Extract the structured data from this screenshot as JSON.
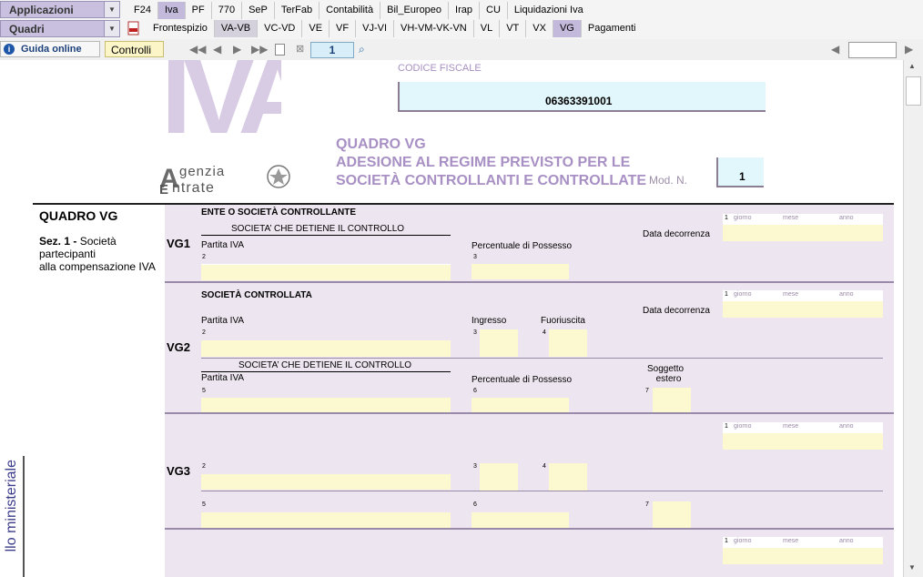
{
  "menu": {
    "applicazioni": "Applicazioni",
    "quadri": "Quadri",
    "top_tabs": [
      "F24",
      "Iva",
      "PF",
      "770",
      "SeP",
      "TerFab",
      "Contabilità",
      "Bil_Europeo",
      "Irap",
      "CU",
      "Liquidazioni Iva"
    ],
    "active_top_tab": "Iva",
    "sub_tabs": [
      "Frontespizio",
      "VA-VB",
      "VC-VD",
      "VE",
      "VF",
      "VJ-VI",
      "VH-VM-VK-VN",
      "VL",
      "VT",
      "VX",
      "VG",
      "Pagamenti"
    ],
    "active_sub_tabs": [
      "VA-VB",
      "VG"
    ]
  },
  "toolbar": {
    "guida_label": "Guida online",
    "controlli_label": "Controlli",
    "page_number": "1",
    "goto_value": ""
  },
  "form": {
    "codice_fiscale_label": "CODICE FISCALE",
    "codice_fiscale": "06363391001",
    "title_line1": "QUADRO VG",
    "title_line2": "ADESIONE AL REGIME PREVISTO PER LE",
    "title_line3": "SOCIETÀ CONTROLLANTI E CONTROLLATE",
    "mod_label": "Mod. N.",
    "mod_value": "1",
    "agenzia_line1": "genzia",
    "agenzia_line2": "ntrate",
    "iva_logo": "IVA",
    "side_title": "QUADRO VG",
    "side_sez": "Sez. 1 -",
    "side_sez_text1": "Società",
    "side_sez_text2": "partecipanti",
    "side_sez_text3": "alla compensazione IVA",
    "vertical_text": "llo ministeriale",
    "vg1": {
      "id": "VG1",
      "section_title": "ENTE O SOCIETÀ CONTROLLANTE",
      "sub_title": "SOCIETA’ CHE DETIENE IL CONTROLLO",
      "partita_iva": "Partita IVA",
      "percentuale": "Percentuale di Possesso",
      "data_decorrenza": "Data decorrenza"
    },
    "vg2": {
      "id": "VG2",
      "section_title": "SOCIETÀ CONTROLLATA",
      "partita_iva": "Partita IVA",
      "ingresso": "Ingresso",
      "fuoriuscita": "Fuoriuscita",
      "data_decorrenza": "Data decorrenza",
      "sub_title": "SOCIETA’ CHE DETIENE IL CONTROLLO",
      "partita_iva2": "Partita IVA",
      "percentuale": "Percentuale di Possesso",
      "soggetto_estero_1": "Soggetto",
      "soggetto_estero_2": "estero"
    },
    "vg3": {
      "id": "VG3"
    },
    "date_labels": {
      "giorno": "giorno",
      "mese": "mese",
      "anno": "anno"
    },
    "nums": {
      "n1": "1",
      "n2": "2",
      "n3": "3",
      "n4": "4",
      "n5": "5",
      "n6": "6",
      "n7": "7"
    }
  }
}
